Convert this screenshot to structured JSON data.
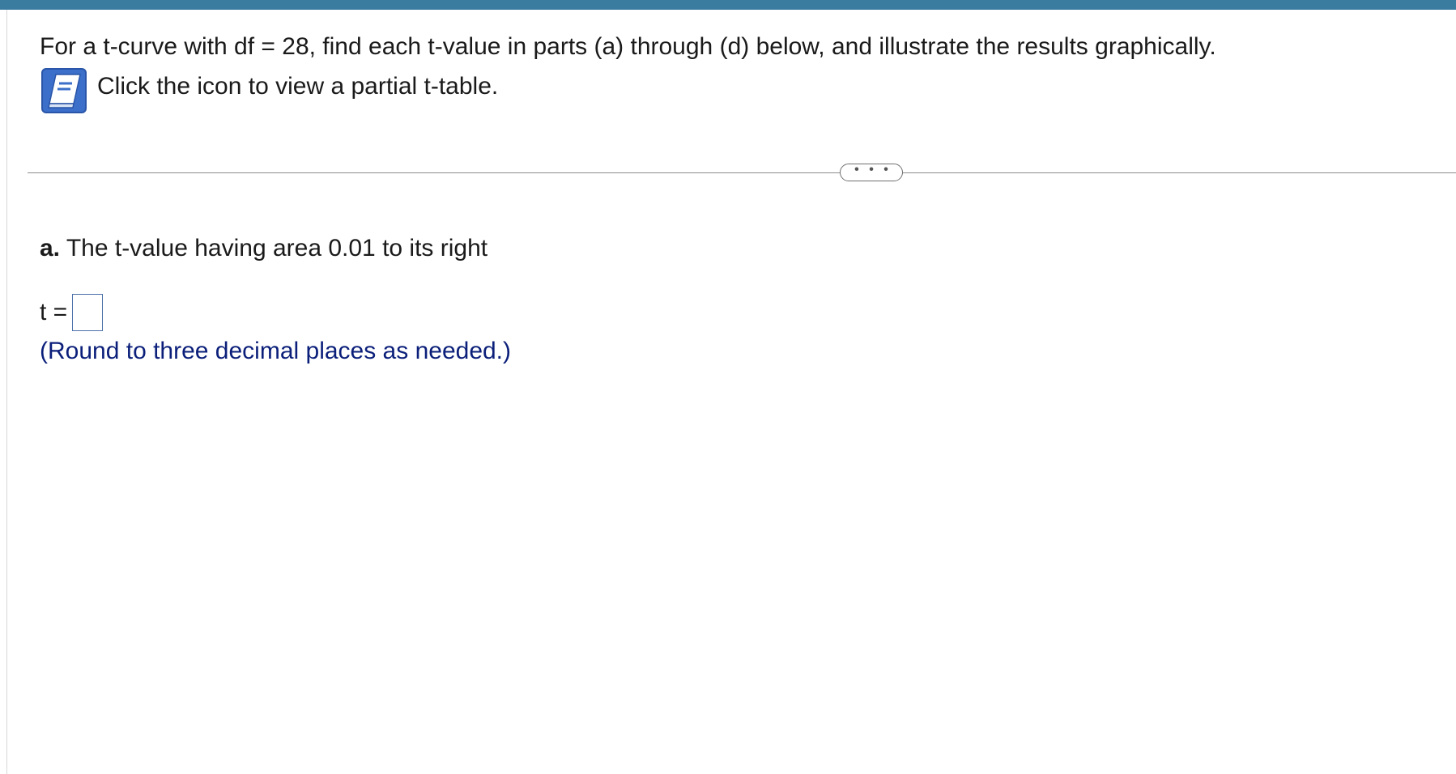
{
  "colors": {
    "top_bar": "#3a7ba0",
    "hint_text": "#0b1f7a",
    "icon_blue": "#3b6fc9"
  },
  "question": {
    "prompt": "For a t-curve with df = 28, find each t-value in parts (a) through (d) below, and illustrate the results graphically.",
    "table_link_icon": "book-icon",
    "table_link_label": "Click the icon to view a partial t-table."
  },
  "divider": {
    "more_icon": "ellipsis-icon",
    "more_label": "• • •"
  },
  "part_a": {
    "letter": "a.",
    "text": "The t-value having area 0.01 to its right",
    "answer_label": "t =",
    "answer_value": "",
    "hint": "(Round to three decimal places as needed.)"
  }
}
